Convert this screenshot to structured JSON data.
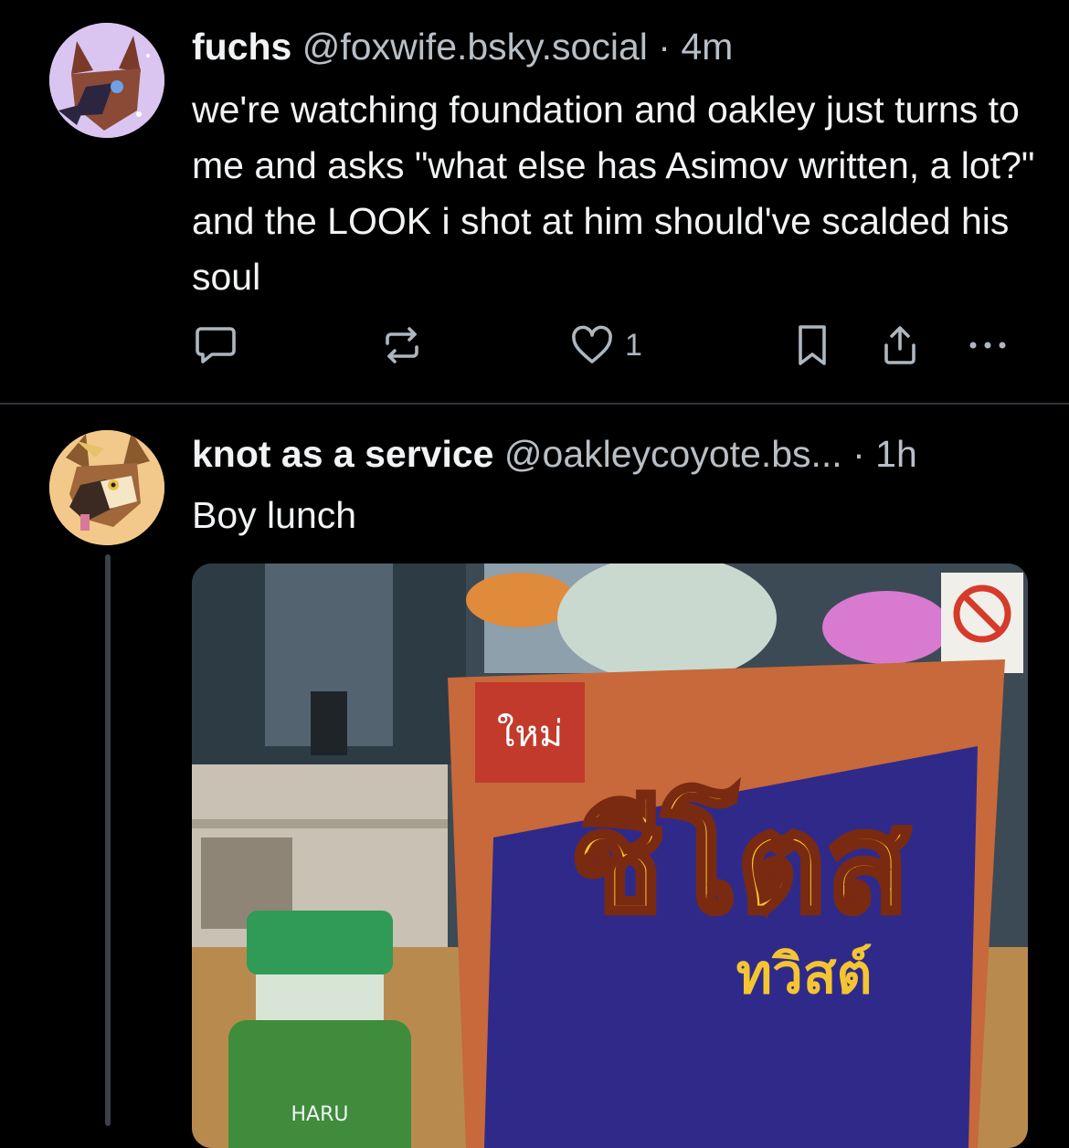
{
  "posts": [
    {
      "author_name": "fuchs",
      "author_handle": "@foxwife.bsky.social",
      "separator": "·",
      "time": "4m",
      "text": "we're watching foundation and oakley just turns to me and asks \"what else has Asimov written, a lot?\" and the LOOK i shot at him should've scalded his soul",
      "like_count": "1",
      "avatar_icon": "fox-avatar-icon"
    },
    {
      "author_name": "knot as a service",
      "author_handle": "@oakleycoyote.bs...",
      "separator": "·",
      "time": "1h",
      "text": "Boy lunch",
      "avatar_icon": "coyote-avatar-icon",
      "image": {
        "bag_label_top": "ใหม่",
        "bag_brand": "ชีโตส",
        "bag_subtitle": "ทวิสต์",
        "bottle_label": "HARU"
      }
    }
  ],
  "colors": {
    "background": "#000000",
    "text": "#f1f3f5",
    "muted": "#b8bfc6",
    "divider": "#2e3439",
    "thread_line": "#3a4148"
  }
}
